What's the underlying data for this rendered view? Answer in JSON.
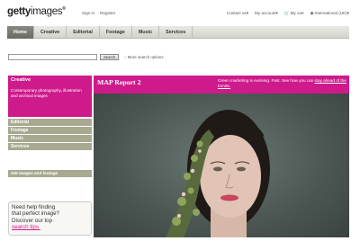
{
  "brand": {
    "logo_bold": "getty",
    "logo_light": "images",
    "mark": "®"
  },
  "header": {
    "signin": "Sign in",
    "register": "Register",
    "contact": "Contact us",
    "account": "My account",
    "cart": "My cart",
    "region": "International (UK)",
    "dropdown_glyph": "▾"
  },
  "nav": {
    "tabs": [
      "Home",
      "Creative",
      "Editorial",
      "Footage",
      "Music",
      "Services"
    ],
    "active": "Home"
  },
  "search": {
    "value": "",
    "button": "Search",
    "more": "More search options"
  },
  "sidebar": {
    "creative_title": "Creative",
    "creative_desc": "Contemporary photography, illustration and archival images",
    "items": [
      "Editorial",
      "Footage",
      "Music",
      "Services"
    ],
    "count": "349 images and footage"
  },
  "help": {
    "line1": "Need help finding",
    "line2": "that perfect image?",
    "line3": "Discover our top",
    "link": "search tips."
  },
  "banner": {
    "title": "MAP Report 2",
    "text": "Green marketing is evolving. Fast. See how you can ",
    "link": "stay ahead of the trends."
  },
  "colors": {
    "magenta": "#cf1a8c",
    "sidebar_grey": "#a7a990",
    "photo_bg": "#55615e"
  }
}
